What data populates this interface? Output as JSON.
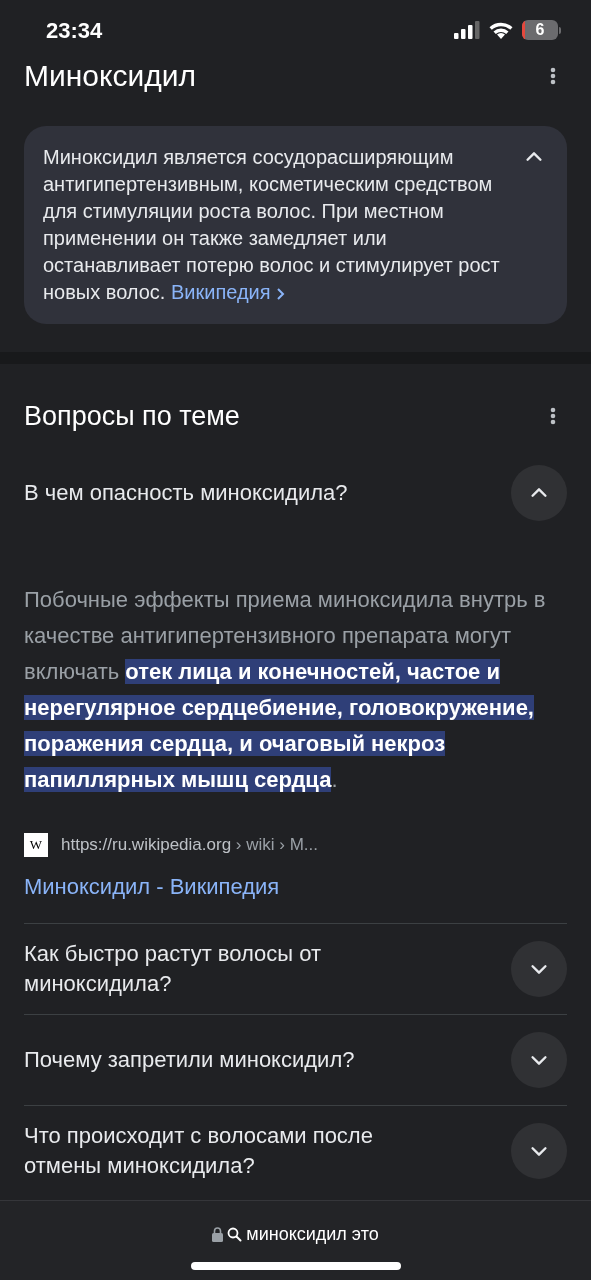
{
  "status_bar": {
    "time": "23:34",
    "battery": "6"
  },
  "title": "Миноксидил",
  "summary": {
    "text": "Миноксидил является сосудорасширяющим антигипертензивным, косметическим средством для стимуляции роста волос. При местном применении он также замедляет или останавливает потерю волос и стимулирует рост новых волос.",
    "link": "Википедия",
    "expanded": true
  },
  "related": {
    "title": "Вопросы по теме",
    "questions": [
      {
        "question": "В чем опасность миноксидила?",
        "expanded": true,
        "answer_before": "Побочные эффекты приема миноксидила внутрь в качестве антигипертензивного препарата могут включать ",
        "answer_highlight": "отек лица и конечностей, частое и нерегулярное сердцебиение, головокружение, поражения сердца, и очаговый некроз папиллярных мышц сердца",
        "answer_after": ".",
        "source_favicon": "W",
        "source_url": "https://ru.wikipedia.org",
        "source_path": "› wiki › M...",
        "source_title": "Миноксидил - Википедия"
      },
      {
        "question": "Как быстро растут волосы от миноксидила?",
        "expanded": false
      },
      {
        "question": "Почему запретили миноксидил?",
        "expanded": false
      },
      {
        "question": "Что происходит с волосами после отмены миноксидила?",
        "expanded": false
      }
    ]
  },
  "address_bar": {
    "query": "миноксидил это"
  }
}
